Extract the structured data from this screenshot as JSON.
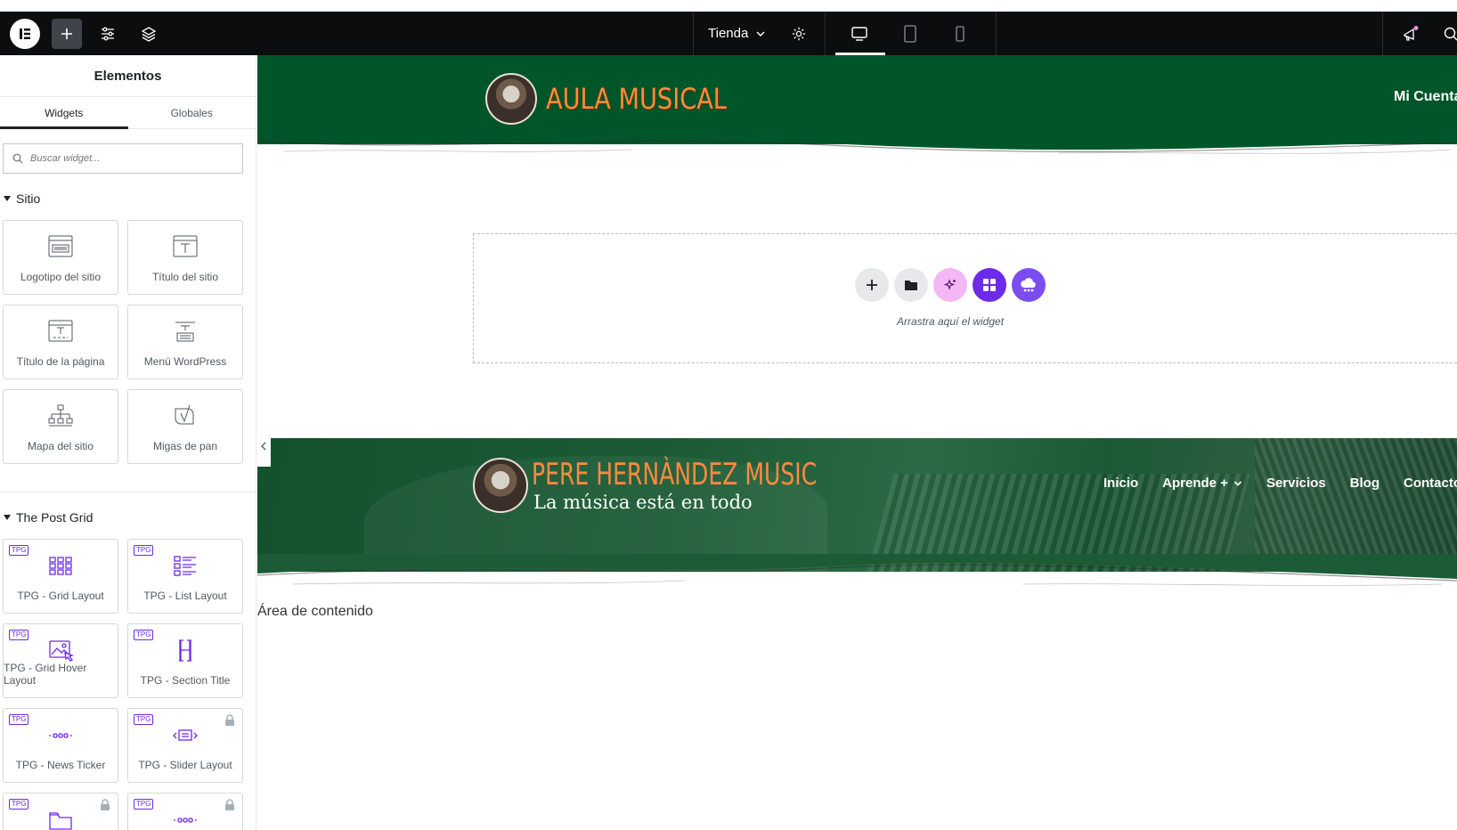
{
  "topbar": {
    "site_selector": "Tienda"
  },
  "sidebar": {
    "title": "Elementos",
    "tabs": [
      "Widgets",
      "Globales"
    ],
    "search_placeholder": "Buscar widget...",
    "categories": [
      {
        "name": "Sitio",
        "widgets": [
          "Logotipo del sitio",
          "Título del sitio",
          "Título de la página",
          "Menú WordPress",
          "Mapa del sitio",
          "Migas de pan"
        ]
      },
      {
        "name": "The Post Grid",
        "badge": "TPG",
        "widgets": [
          "TPG - Grid Layout",
          "TPG - List Layout",
          "TPG - Grid Hover Layout",
          "TPG - Section Title",
          "TPG - News Ticker",
          "TPG - Slider Layout"
        ]
      }
    ]
  },
  "canvas": {
    "header1": {
      "brand": "AULA  MUSICAL",
      "account_link": "Mi Cuenta"
    },
    "dropzone": {
      "hint": "Arrastra aquí el widget"
    },
    "header2": {
      "brand_title": "PERE HERNÀNDEZ MUSIC",
      "brand_subtitle": "La música está en todo",
      "nav": [
        "Inicio",
        "Aprende +",
        "Servicios",
        "Blog",
        "Contacto"
      ]
    },
    "content_area_label": "Área de contenido"
  },
  "colors": {
    "header_green": "#005629",
    "brand_orange": "#ff8a3d",
    "topbar_black": "#0c0d0e",
    "accent_purple": "#6d2ae8",
    "ai_pink": "#f3b7f5"
  }
}
